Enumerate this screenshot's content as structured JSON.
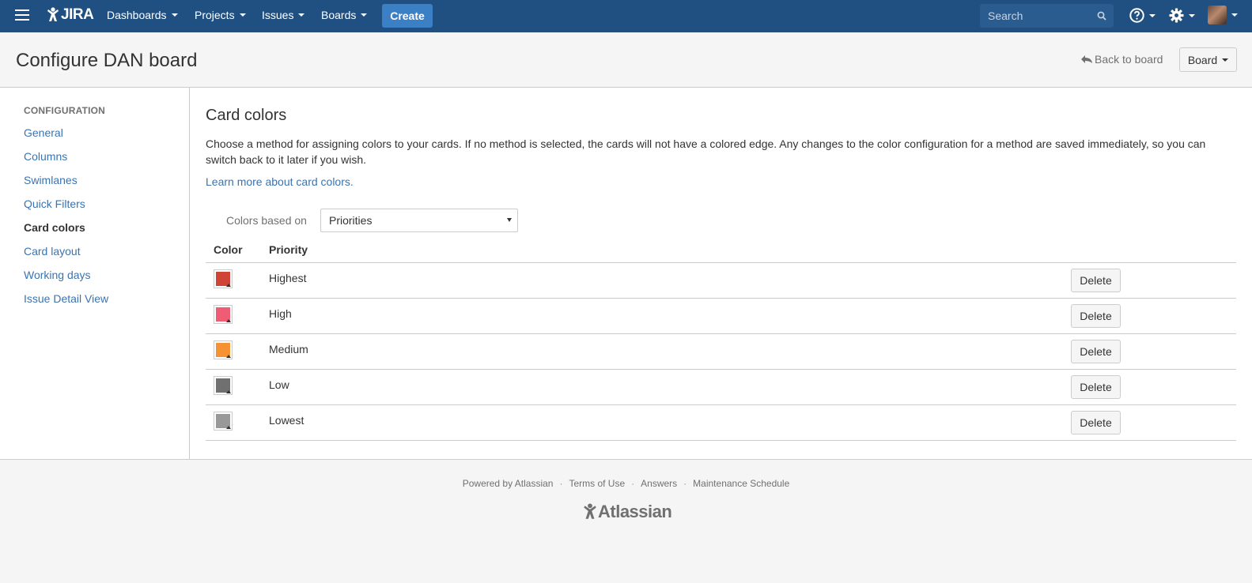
{
  "nav": {
    "logo_text": "JIRA",
    "items": [
      {
        "label": "Dashboards"
      },
      {
        "label": "Projects"
      },
      {
        "label": "Issues"
      },
      {
        "label": "Boards"
      }
    ],
    "create_label": "Create",
    "search_placeholder": "Search"
  },
  "header": {
    "title": "Configure DAN board",
    "back_label": "Back to board",
    "board_label": "Board"
  },
  "sidebar": {
    "heading": "CONFIGURATION",
    "items": [
      {
        "label": "General"
      },
      {
        "label": "Columns"
      },
      {
        "label": "Swimlanes"
      },
      {
        "label": "Quick Filters"
      },
      {
        "label": "Card colors",
        "active": true
      },
      {
        "label": "Card layout"
      },
      {
        "label": "Working days"
      },
      {
        "label": "Issue Detail View"
      }
    ]
  },
  "main": {
    "title": "Card colors",
    "description": "Choose a method for assigning colors to your cards. If no method is selected, the cards will not have a colored edge. Any changes to the color configuration for a method are saved immediately, so you can switch back to it later if you wish.",
    "learn_more": "Learn more about card colors.",
    "based_on_label": "Colors based on",
    "based_on_value": "Priorities",
    "columns": {
      "color": "Color",
      "priority": "Priority"
    },
    "delete_label": "Delete",
    "rows": [
      {
        "name": "Highest",
        "color": "#d04437"
      },
      {
        "name": "High",
        "color": "#f15c75"
      },
      {
        "name": "Medium",
        "color": "#f79232"
      },
      {
        "name": "Low",
        "color": "#707070"
      },
      {
        "name": "Lowest",
        "color": "#999999"
      }
    ]
  },
  "footer": {
    "links": [
      "Powered by Atlassian",
      "Terms of Use",
      "Answers",
      "Maintenance Schedule"
    ],
    "separator": "·",
    "logo_text": "Atlassian"
  }
}
